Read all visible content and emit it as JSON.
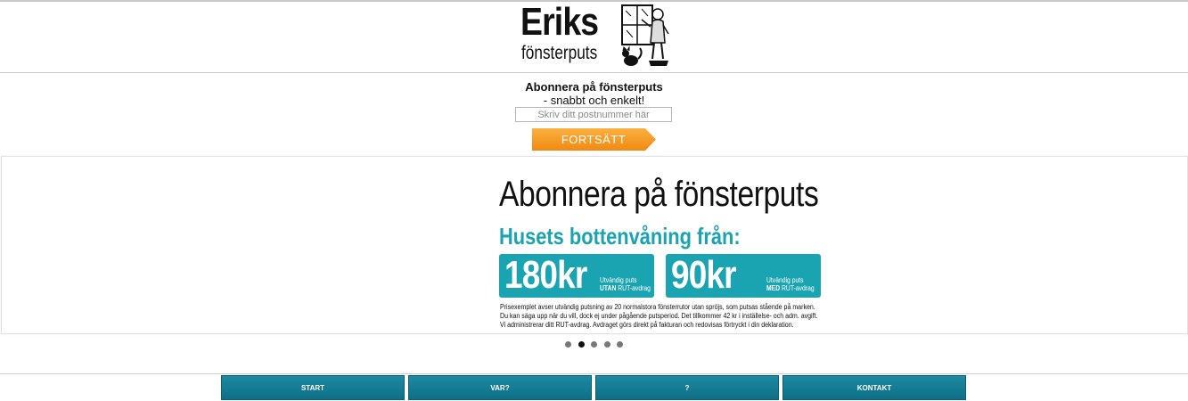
{
  "header": {
    "logo_line1": "Eriks",
    "logo_line2": "fönsterputs"
  },
  "subscribe": {
    "title": "Abonnera på fönsterputs",
    "subtitle": "- snabbt och enkelt!",
    "zip_placeholder": "Skriv ditt postnummer här",
    "button_label": "FORTSÄTT"
  },
  "slide": {
    "title": "Abonnera på fönsterputs",
    "subtitle": "Husets bottenvåning från:",
    "prices": [
      {
        "value": "180kr",
        "note_line1": "Utvändig puts",
        "note_line2_bold": "UTAN",
        "note_line2_rest": " RUT-avdrag"
      },
      {
        "value": "90kr",
        "note_line1": "Utvändig puts",
        "note_line2_bold": "MED",
        "note_line2_rest": " RUT-avdrag"
      }
    ],
    "fine_print": [
      "Prisexemplet avser utvändig putsning av 20 normalstora fönsterrutor utan spröjs, som putsas stående på marken.",
      "Du kan säga upp när du vill, dock ej under pågående putsperiod. Det tillkommer 42 kr i inställelse- och adm. avgift.",
      "Vi administrerar ditt RUT-avdrag. Avdraget görs direkt på fakturan och redovisas förtryckt i din deklaration."
    ]
  },
  "carousel": {
    "dot_count": 5,
    "active_index": 1
  },
  "nav": {
    "items": [
      "START",
      "VAR?",
      "?",
      "KONTAKT"
    ]
  },
  "colors": {
    "accent_teal": "#1aa3b0",
    "nav_blue": "#127a92",
    "button_orange": "#f7941d"
  }
}
